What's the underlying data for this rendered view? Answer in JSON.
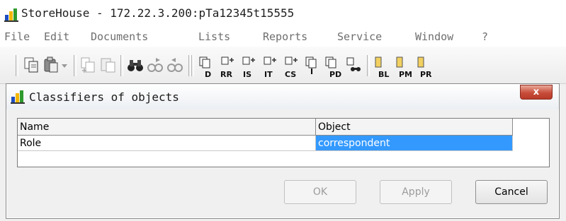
{
  "window": {
    "title": "StoreHouse - 172.22.3.200:pTa12345t15555"
  },
  "menu": {
    "items": [
      "File",
      "Edit",
      "Documents",
      "Lists",
      "Reports",
      "Service",
      "Window",
      "?"
    ]
  },
  "toolbar": {
    "buttons": [
      {
        "name": "copy-icon"
      },
      {
        "name": "paste-icon"
      },
      {
        "name": "dropdown-arrow-icon"
      },
      {
        "name": "copy-add-icon"
      },
      {
        "name": "paste-add-icon"
      },
      {
        "name": "binoculars-icon"
      },
      {
        "name": "find-next-icon"
      },
      {
        "name": "find-prev-icon"
      },
      {
        "name": "doc-d-icon",
        "label": "D"
      },
      {
        "name": "doc-rr-icon",
        "label": "RR"
      },
      {
        "name": "doc-is-icon",
        "label": "IS"
      },
      {
        "name": "doc-it-icon",
        "label": "IT"
      },
      {
        "name": "doc-cs-icon",
        "label": "CS"
      },
      {
        "name": "doc-i-icon",
        "label": "I"
      },
      {
        "name": "doc-pd-icon",
        "label": "PD"
      },
      {
        "name": "doc-find-icon"
      },
      {
        "name": "list-bl-icon",
        "label": "BL"
      },
      {
        "name": "list-pm-icon",
        "label": "PM"
      },
      {
        "name": "list-pr-icon",
        "label": "PR"
      }
    ]
  },
  "dialog": {
    "title": "Classifiers of objects",
    "close_label": "x",
    "columns": [
      "Name",
      "Object"
    ],
    "rows": [
      {
        "name": "Role",
        "object": "correspondent"
      }
    ],
    "buttons": {
      "ok": "OK",
      "apply": "Apply",
      "cancel": "Cancel"
    }
  },
  "colors": {
    "selection": "#3399ff",
    "close_button": "#c84d3a"
  }
}
